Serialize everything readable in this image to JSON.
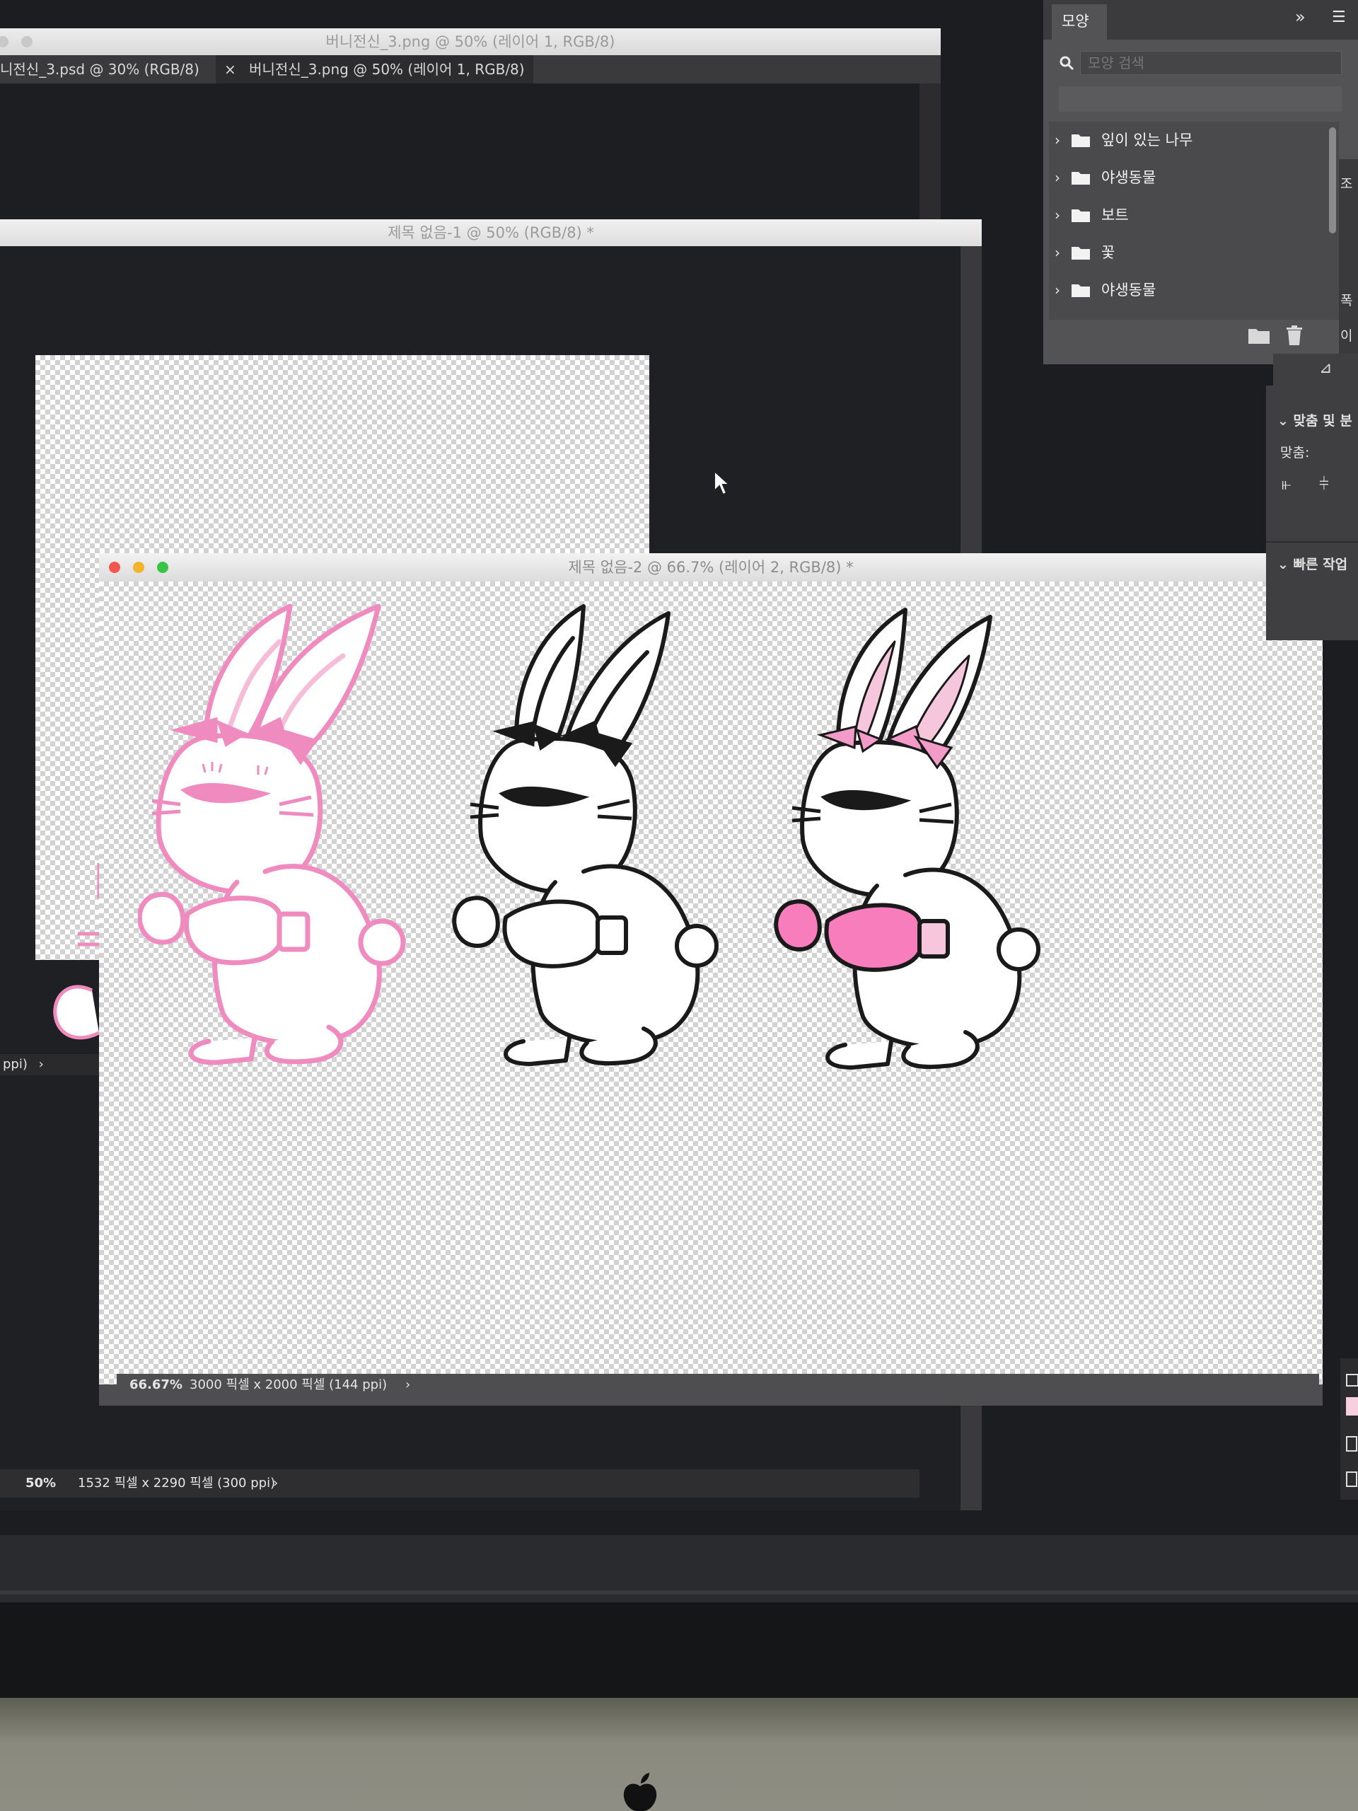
{
  "window1": {
    "title": "버니전신_3.png @ 50% (레이어 1, RGB/8)",
    "tabs": [
      {
        "label": "니전신_3.psd @ 30% (RGB/8)"
      },
      {
        "label": "버니전신_3.png @ 50% (레이어 1, RGB/8)",
        "close": "×"
      }
    ]
  },
  "window2": {
    "title": "제목 없음-1 @ 50% (RGB/8) *",
    "status_left": "ppi)",
    "status_zoom": "50%",
    "status_size": "1532 픽셀 x 2290 픽셀 (300 ppi)",
    "status_arrow": "›"
  },
  "window3": {
    "title": "제목 없음-2 @ 66.7% (레이어 2, RGB/8) *",
    "status_zoom": "66.67%",
    "status_size": "3000 픽셀 x 2000 픽셀 (144 ppi)",
    "status_arrow": "›",
    "colors": {
      "pink": "#f08bbf",
      "pink_fill": "#f77dbd",
      "black": "#1a1a1a",
      "white": "#ffffff"
    }
  },
  "shapes_panel": {
    "tab_label": "모양",
    "collapse": "»",
    "menu": "☰",
    "search_placeholder": "모양 검색",
    "items": [
      {
        "label": "잎이 있는 나무"
      },
      {
        "label": "야생동물"
      },
      {
        "label": "보트"
      },
      {
        "label": "꽃"
      },
      {
        "label": "야생동물"
      }
    ],
    "chevron": "›"
  },
  "properties_panel": {
    "section_align": "맞춤 및 분",
    "align_label": "맞춤:",
    "section_quick": "빠른 작업",
    "side_labels": [
      "조",
      "폭",
      "이"
    ]
  }
}
